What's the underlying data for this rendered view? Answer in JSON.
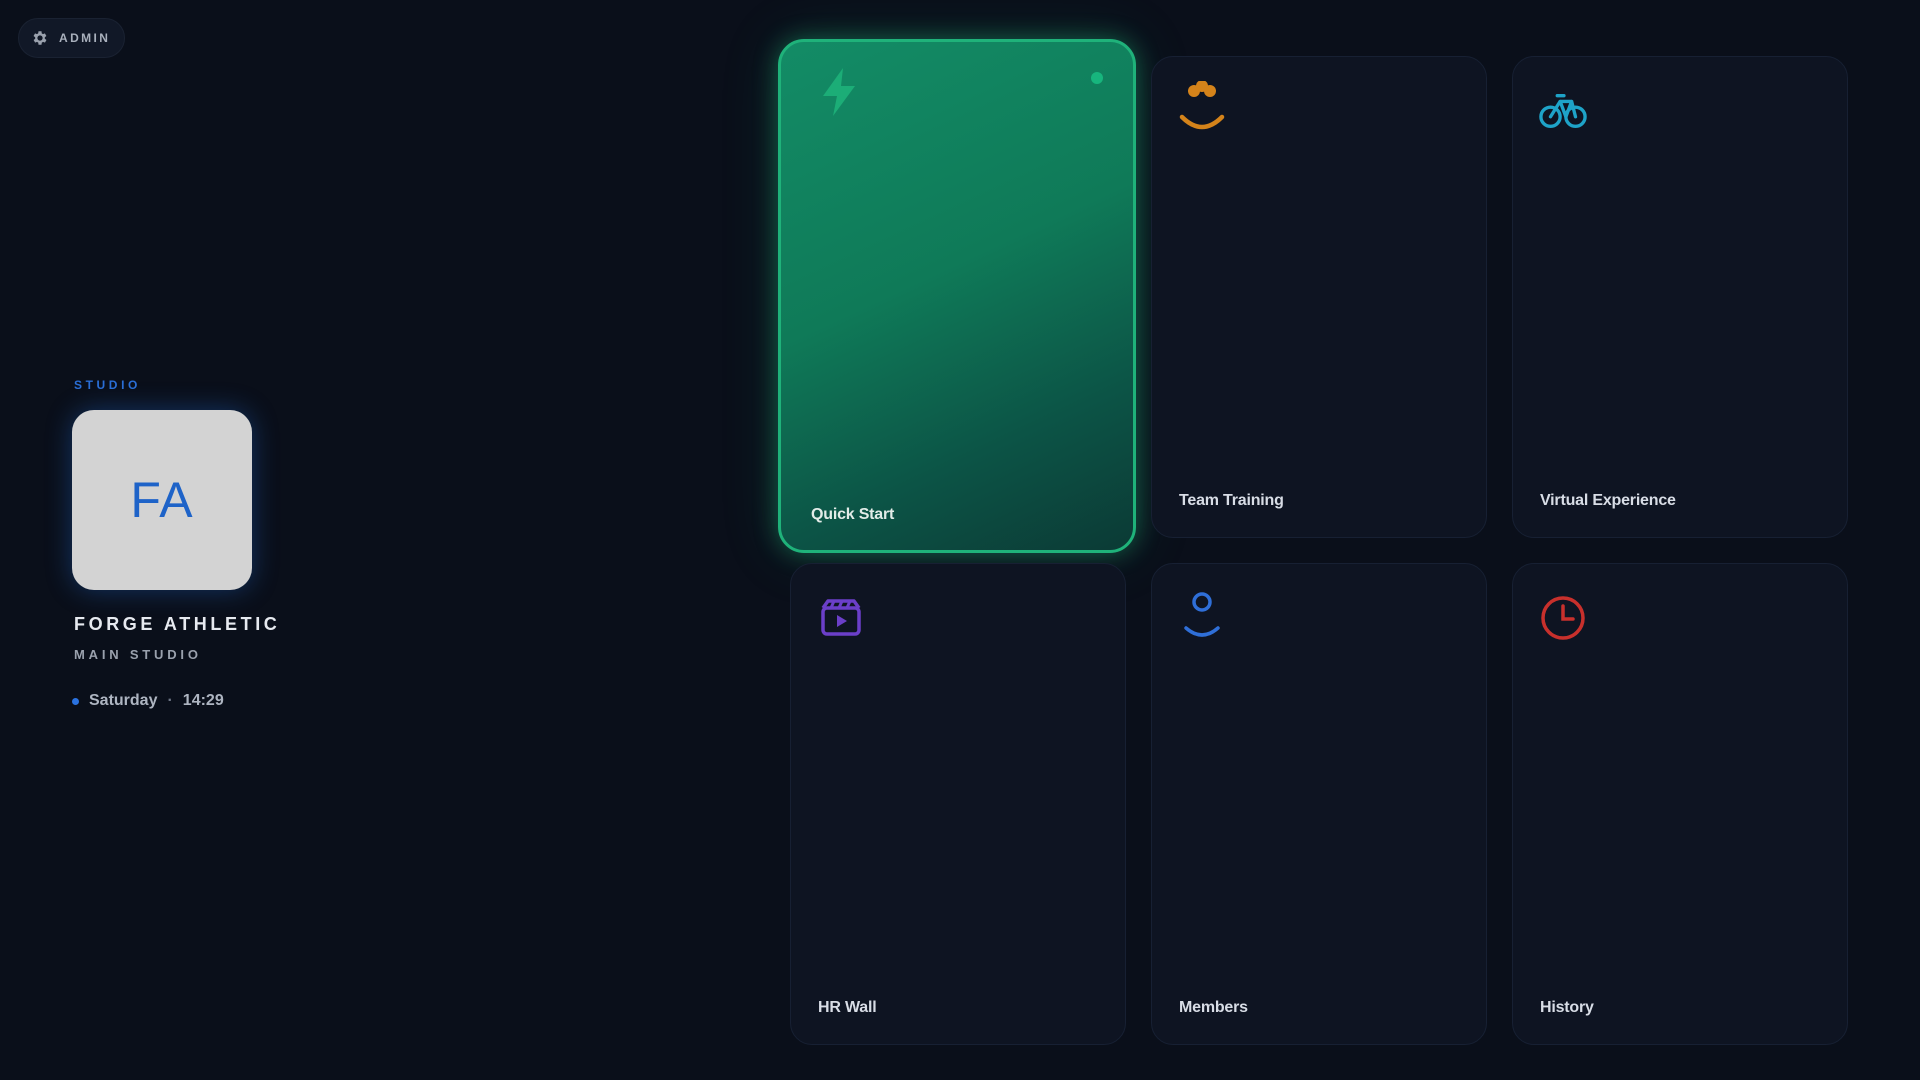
{
  "admin": {
    "label": "ADMIN",
    "icon": "gear-icon"
  },
  "studio": {
    "kicker": "STUDIO",
    "logo_initials": "FA",
    "name": "FORGE ATHLETIC",
    "subtitle": "MAIN STUDIO",
    "day": "Saturday",
    "separator": "·",
    "time": "14:29"
  },
  "tiles": [
    {
      "label": "Quick Start",
      "icon": "lightning-icon",
      "color": "#1fb27a",
      "active": true
    },
    {
      "label": "Team Training",
      "icon": "team-icon",
      "color": "#d4831a"
    },
    {
      "label": "Virtual Experience",
      "icon": "bicycle-icon",
      "color": "#1ea3c8"
    },
    {
      "label": "HR Wall",
      "icon": "video-clapper-icon",
      "color": "#6b3fc9"
    },
    {
      "label": "Members",
      "icon": "person-icon",
      "color": "#2f6fd8"
    },
    {
      "label": "History",
      "icon": "clock-icon",
      "color": "#c8302c"
    }
  ]
}
